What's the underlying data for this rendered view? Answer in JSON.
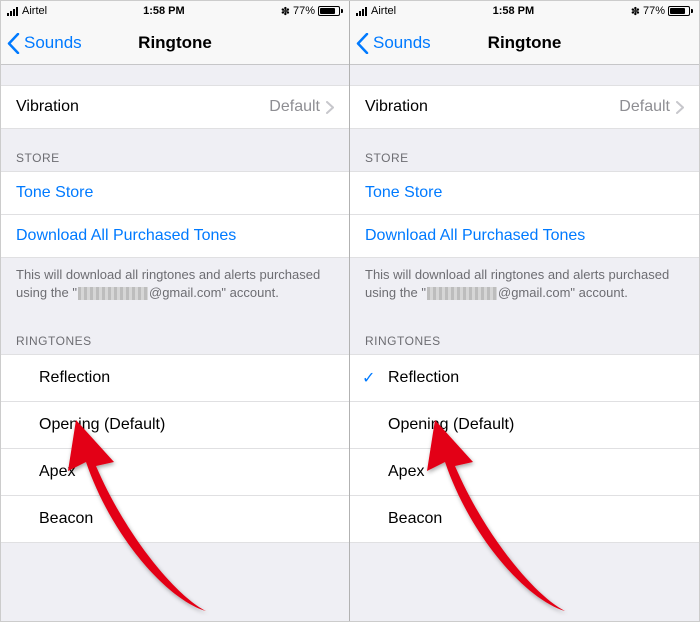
{
  "statusbar": {
    "carrier": "Airtel",
    "time": "1:58 PM",
    "battery_pct": "77%",
    "bluetooth_glyph": "✽"
  },
  "navbar": {
    "back_label": "Sounds",
    "title": "Ringtone"
  },
  "vibration": {
    "label": "Vibration",
    "value": "Default"
  },
  "store": {
    "header": "STORE",
    "tone_store": "Tone Store",
    "download_all": "Download All Purchased Tones",
    "footer_pre": "This will download all ringtones and alerts purchased using the \"",
    "footer_post": "@gmail.com\" account."
  },
  "ringtones": {
    "header": "RINGTONES",
    "items": [
      {
        "label": "Reflection"
      },
      {
        "label": "Opening (Default)"
      },
      {
        "label": "Apex"
      },
      {
        "label": "Beacon"
      }
    ]
  },
  "panels": {
    "left": {
      "selected": null
    },
    "right": {
      "selected": 0
    }
  }
}
